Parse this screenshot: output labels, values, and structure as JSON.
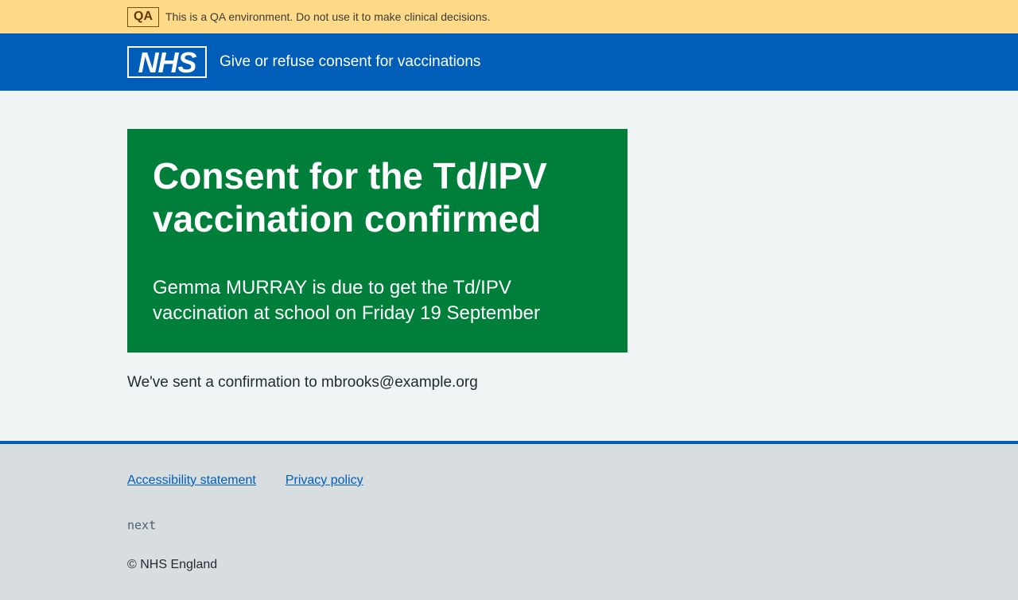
{
  "env_banner": {
    "tag": "QA",
    "message": "This is a QA environment. Do not use it to make clinical decisions."
  },
  "header": {
    "logo_text": "NHS",
    "service_name": "Give or refuse consent for vaccinations"
  },
  "panel": {
    "title": "Consent for the Td/IPV vaccination confirmed",
    "body": "Gemma MURRAY is due to get the Td/IPV vaccination at school on Friday 19 September"
  },
  "confirmation": "We've sent a confirmation to mbrooks@example.org",
  "footer": {
    "links": [
      {
        "label": "Accessibility statement"
      },
      {
        "label": "Privacy policy"
      }
    ],
    "version": "next",
    "copyright": "© NHS England"
  },
  "colors": {
    "nhs_blue": "#005eb8",
    "panel_green": "#007f3b",
    "env_banner": "#ffda89",
    "page_background": "#f0f4f5",
    "footer_background": "#d8dde0"
  }
}
